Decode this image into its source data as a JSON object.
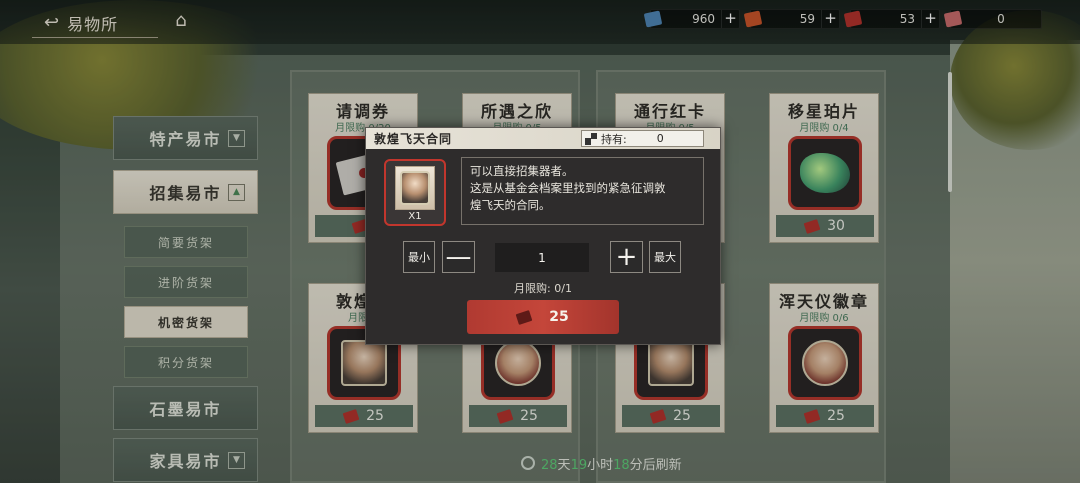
{
  "topbar": {
    "back_label": "易物所",
    "currencies": [
      {
        "value": "960",
        "color": "#4f86b5",
        "name": "blue-ticket"
      },
      {
        "value": "59",
        "color": "#c8552a",
        "name": "orange-ticket"
      },
      {
        "value": "53",
        "color": "#b3322c",
        "name": "red-ticket"
      },
      {
        "value": "0",
        "color": "#c96c6c",
        "name": "pink-card"
      }
    ],
    "plus_label": "+"
  },
  "sidebar": {
    "items": [
      {
        "label": "特产易市",
        "caret": "▼"
      },
      {
        "label": "招集易市",
        "caret": "▲"
      },
      {
        "label": "石墨易市"
      },
      {
        "label": "家具易市",
        "caret": "▼"
      }
    ],
    "sub_items": [
      {
        "label": "简要货架"
      },
      {
        "label": "进阶货架"
      },
      {
        "label": "机密货架"
      },
      {
        "label": "积分货架"
      }
    ]
  },
  "cards": [
    {
      "title": "请调券",
      "limit": "月限购 0/20",
      "price": ""
    },
    {
      "title": "所遇之欣",
      "limit": "月限购 0/5",
      "price": ""
    },
    {
      "title": "通行红卡",
      "limit": "月限购 0/5",
      "price": ""
    },
    {
      "title": "移星珀片",
      "limit": "月限购 0/4",
      "price": "30"
    },
    {
      "title": "敦煌飞",
      "limit": "月限购",
      "price": "25"
    },
    {
      "title": "",
      "limit": "",
      "price": "25"
    },
    {
      "title": "",
      "limit": "",
      "price": "25"
    },
    {
      "title": "浑天仪徽章",
      "limit": "月限购 0/6",
      "price": "25"
    }
  ],
  "modal": {
    "title": "敦煌飞天合同",
    "hold_label": "持有:",
    "hold_value": "0",
    "item_qty": "X1",
    "desc_lines": [
      "可以直接招集器者。",
      "这是从基金会档案里找到的紧急征调敦",
      "煌飞天的合同。"
    ],
    "min_label": "最小",
    "max_label": "最大",
    "minus_label": "—",
    "plus_label": "+",
    "quantity": "1",
    "limit_text": "月限购: 0/1",
    "price": "25"
  },
  "refresh": {
    "days": "28",
    "day_unit": "天",
    "hours": "19",
    "hour_unit": "小时",
    "minutes": "18",
    "minute_unit": "分后刷新"
  }
}
